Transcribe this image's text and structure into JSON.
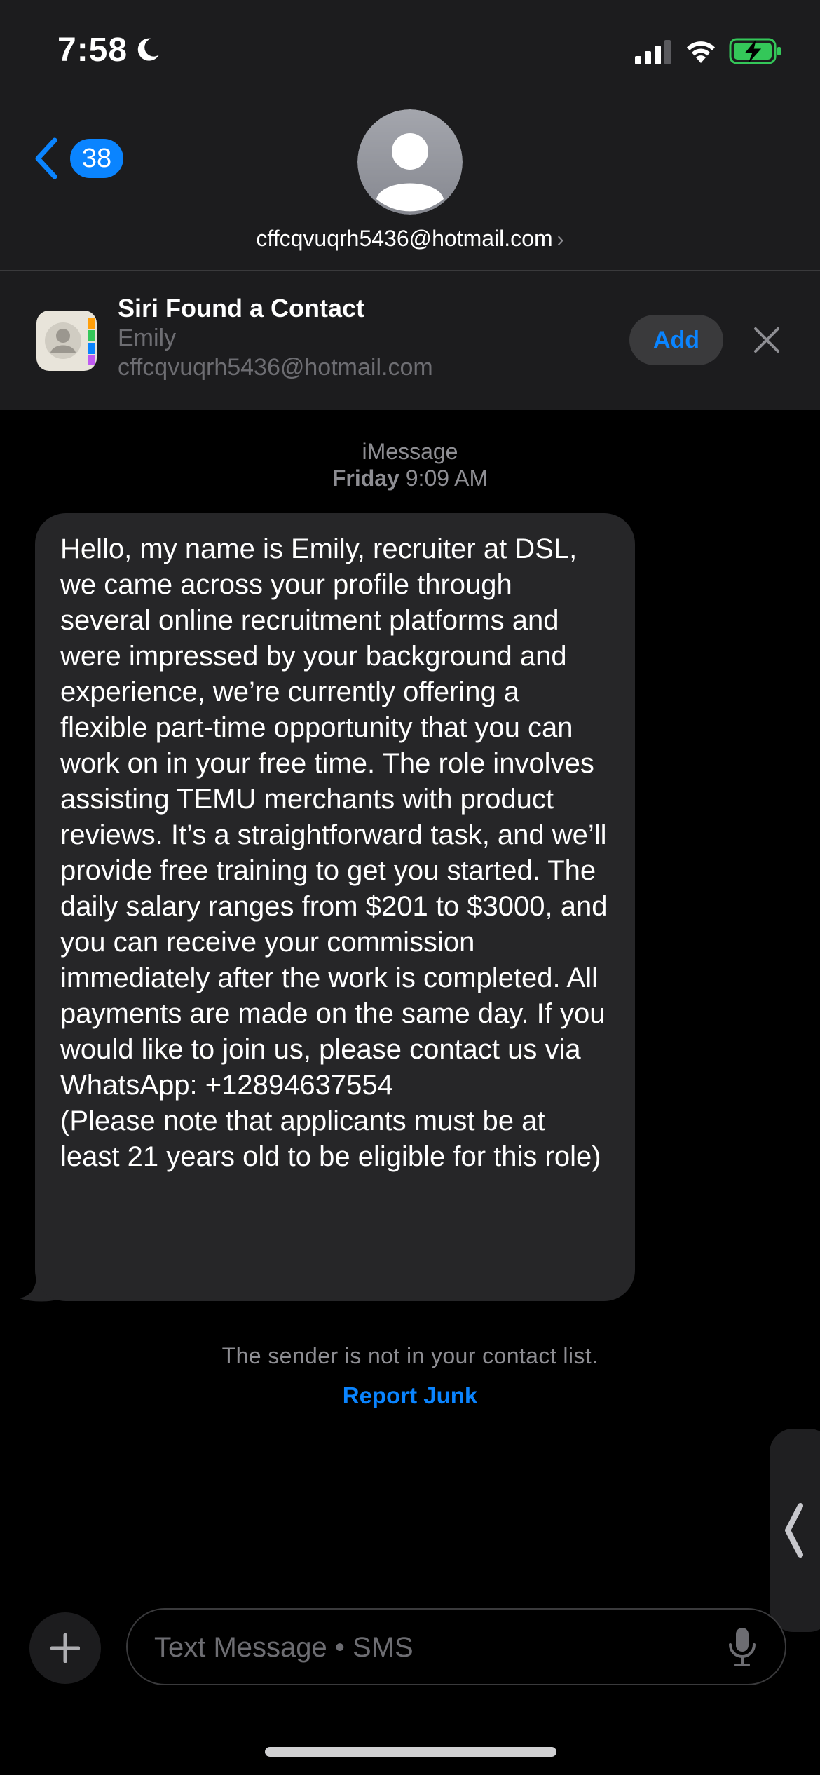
{
  "status_bar": {
    "time": "7:58",
    "focus_icon": "moon-icon",
    "signal_icon": "cellular-signal-icon",
    "wifi_icon": "wifi-icon",
    "battery_icon": "battery-charging-icon",
    "battery_color": "#34c759"
  },
  "header": {
    "back_icon": "chevron-left-icon",
    "unread_count": "38",
    "avatar_icon": "person-avatar-icon",
    "contact": "cffcqvuqrh5436@hotmail.com",
    "contact_chevron": "›"
  },
  "siri_banner": {
    "app_icon": "contacts-app-icon",
    "title": "Siri Found a Contact",
    "name": "Emily",
    "email": "cffcqvuqrh5436@hotmail.com",
    "add_label": "Add",
    "dismiss_icon": "close-icon"
  },
  "conversation": {
    "service": "iMessage",
    "day": "Friday",
    "time": "9:09 AM",
    "message": "Hello, my name is Emily, recruiter at DSL, we came across your profile through several online recruitment platforms and were impressed by your background and experience, we’re currently offering a flexible part-time opportunity that you can work on in your free time. The role involves assisting TEMU merchants with product reviews. It’s a straightforward task, and we’ll provide free training to get you started. The daily salary ranges from $201 to $3000, and you can receive your commission immediately after the work is completed. All payments are made on the same day. If you would like to join us, please contact us via WhatsApp: +12894637554\n(Please note that applicants must be at least 21 years old to be eligible for this role)",
    "not_in_contacts": "The sender is not in your contact list.",
    "report_junk": "Report Junk"
  },
  "input_bar": {
    "plus_icon": "plus-icon",
    "placeholder": "Text Message • SMS",
    "mic_icon": "microphone-icon"
  },
  "side_handle_icon": "chevron-left-icon",
  "colors": {
    "accent": "#0a84ff",
    "background": "#000000",
    "header_background": "#1c1c1e",
    "bubble": "#262628",
    "secondary_text": "#8e8e93"
  }
}
